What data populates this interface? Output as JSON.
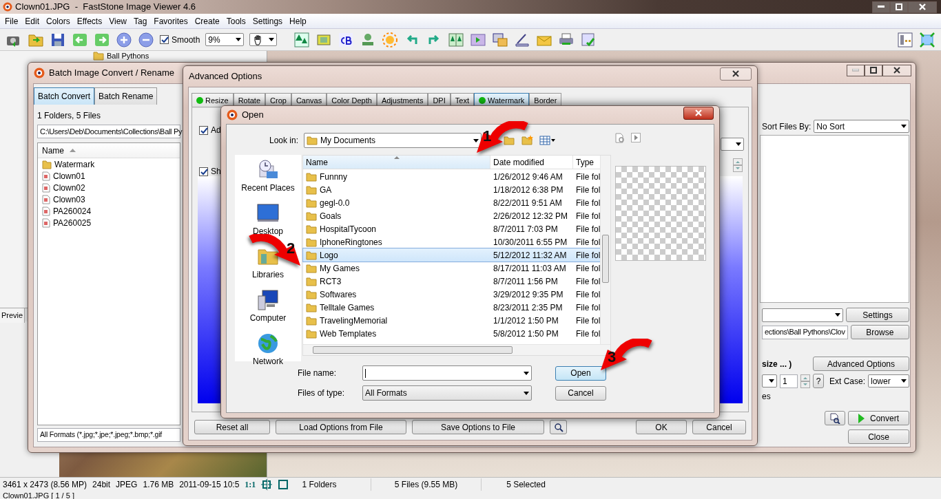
{
  "app": {
    "title": "Clown01.JPG  -  FastStone Image Viewer 4.6",
    "menu": [
      "File",
      "Edit",
      "Colors",
      "Effects",
      "View",
      "Tag",
      "Favorites",
      "Create",
      "Tools",
      "Settings",
      "Help"
    ],
    "smooth": {
      "label": "Smooth",
      "checked": true
    },
    "zoom": "9%",
    "tree_item": "Ball Pythons",
    "preview_tab": "Previe",
    "status": [
      "3461 x 2473 (8.56 MP)",
      "24bit",
      "JPEG",
      "1.76 MB",
      "2011-09-15 10:5",
      "1:1"
    ],
    "browser_status": [
      "1 Folders",
      "5 Files (9.55 MB)",
      "5 Selected"
    ],
    "footer": "Clown01.JPG [ 1 / 5 ]"
  },
  "batch": {
    "title": "Batch Image Convert / Rename",
    "tabs": [
      {
        "label": "Batch Convert",
        "selected": true
      },
      {
        "label": "Batch Rename",
        "selected": false
      }
    ],
    "summary": "1 Folders, 5 Files",
    "path": "C:\\Users\\Deb\\Documents\\Collections\\Ball Py",
    "name_column": "Name",
    "files": [
      {
        "name": "Watermark",
        "kind": "folder"
      },
      {
        "name": "Clown01",
        "kind": "image"
      },
      {
        "name": "Clown02",
        "kind": "image"
      },
      {
        "name": "Clown03",
        "kind": "image"
      },
      {
        "name": "PA260024",
        "kind": "image"
      },
      {
        "name": "PA260025",
        "kind": "image"
      }
    ],
    "filter": "All Formats (*.jpg;*.jpe;*.jpeg;*.bmp;*.gif",
    "sort_label": "Sort Files By:",
    "sort_value": "No Sort",
    "settings_button": "Settings",
    "output_path": "ections\\Ball Pythons\\Clov",
    "browse_button": "Browse",
    "size_text": "size ... )",
    "advanced_button": "Advanced Options",
    "start_number": "1",
    "help_button": "?",
    "ext_case_label": "Ext Case:",
    "ext_case": "lower",
    "partial_text": "es",
    "convert_button": "Convert",
    "close_button": "Close"
  },
  "advanced": {
    "title": "Advanced Options",
    "tabs": [
      {
        "label": "Resize",
        "enabled": true,
        "selected": false
      },
      {
        "label": "Rotate",
        "enabled": false,
        "selected": false
      },
      {
        "label": "Crop",
        "enabled": false,
        "selected": false
      },
      {
        "label": "Canvas",
        "enabled": false,
        "selected": false
      },
      {
        "label": "Color Depth",
        "enabled": false,
        "selected": false
      },
      {
        "label": "Adjustments",
        "enabled": false,
        "selected": false
      },
      {
        "label": "DPI",
        "enabled": false,
        "selected": false
      },
      {
        "label": "Text",
        "enabled": false,
        "selected": false
      },
      {
        "label": "Watermark",
        "enabled": true,
        "selected": true
      },
      {
        "label": "Border",
        "enabled": false,
        "selected": false
      }
    ],
    "checks": [
      {
        "label": "Ad",
        "checked": true
      },
      {
        "label": "Sh",
        "checked": true
      }
    ],
    "buttons": [
      "Reset all",
      "Load Options from File",
      "Save Options to File",
      "OK",
      "Cancel"
    ]
  },
  "open": {
    "title": "Open",
    "look_in_label": "Look in:",
    "look_in": "My Documents",
    "places": [
      "Recent Places",
      "Desktop",
      "Libraries",
      "Computer",
      "Network"
    ],
    "columns": [
      "Name",
      "Date modified",
      "Type"
    ],
    "rows": [
      {
        "name": "Funnny",
        "date": "1/26/2012 9:46 AM",
        "type": "File fol",
        "selected": false
      },
      {
        "name": "GA",
        "date": "1/18/2012 6:38 PM",
        "type": "File fol",
        "selected": false
      },
      {
        "name": "gegl-0.0",
        "date": "8/22/2011 9:51 AM",
        "type": "File fol",
        "selected": false
      },
      {
        "name": "Goals",
        "date": "2/26/2012 12:32 PM",
        "type": "File fol",
        "selected": false
      },
      {
        "name": "HospitalTycoon",
        "date": "8/7/2011 7:03 PM",
        "type": "File fol",
        "selected": false
      },
      {
        "name": "IphoneRingtones",
        "date": "10/30/2011 6:55 PM",
        "type": "File fol",
        "selected": false
      },
      {
        "name": "Logo",
        "date": "5/12/2012 11:32 AM",
        "type": "File fol",
        "selected": true
      },
      {
        "name": "My Games",
        "date": "8/17/2011 11:03 AM",
        "type": "File fol",
        "selected": false
      },
      {
        "name": "RCT3",
        "date": "8/7/2011 1:56 PM",
        "type": "File fol",
        "selected": false
      },
      {
        "name": "Softwares",
        "date": "3/29/2012 9:35 PM",
        "type": "File fol",
        "selected": false
      },
      {
        "name": "Telltale Games",
        "date": "8/23/2011 2:35 PM",
        "type": "File fol",
        "selected": false
      },
      {
        "name": "TravelingMemorial",
        "date": "1/1/2012 1:50 PM",
        "type": "File fol",
        "selected": false
      },
      {
        "name": "Web Templates",
        "date": "5/8/2012 1:50 PM",
        "type": "File fol",
        "selected": false
      }
    ],
    "file_name_label": "File name:",
    "file_type_label": "Files of type:",
    "file_type": "All Formats",
    "buttons": [
      {
        "label": "Open",
        "kind": "default"
      },
      {
        "label": "Cancel",
        "kind": "normal"
      }
    ]
  },
  "annotations": [
    {
      "number": "1"
    },
    {
      "number": "2"
    },
    {
      "number": "3"
    }
  ]
}
